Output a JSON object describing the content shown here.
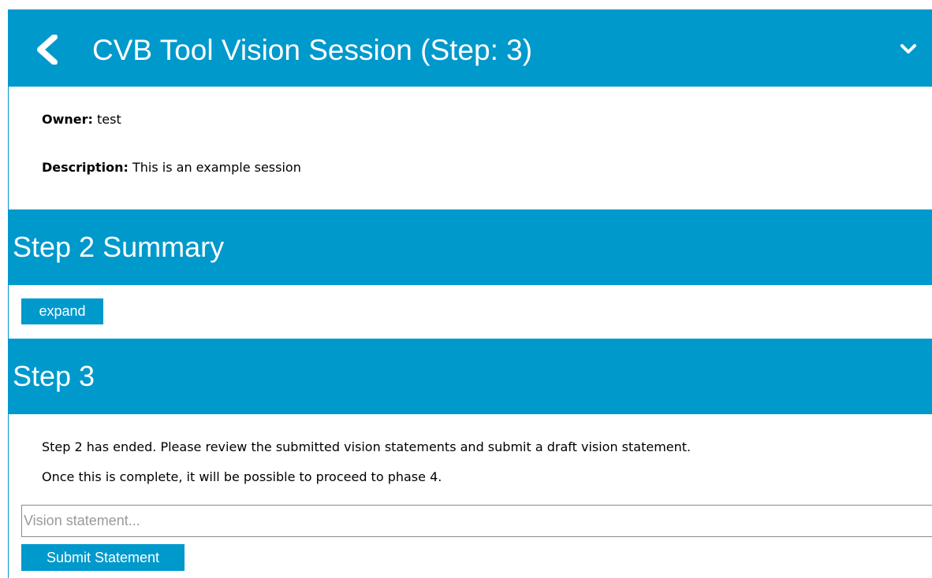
{
  "header": {
    "title": "CVB Tool Vision Session (Step: 3)",
    "back_icon": "back-chevron-left-icon",
    "menu_icon": "chevron-down-icon"
  },
  "session": {
    "owner_label": "Owner:",
    "owner_value": "test",
    "description_label": "Description:",
    "description_value": "This is an example session"
  },
  "step2_summary": {
    "heading": "Step 2 Summary",
    "expand_label": "expand"
  },
  "step3": {
    "heading": "Step 3",
    "line1": "Step 2 has ended. Please review the submitted vision statements and submit a draft vision statement.",
    "line2": "Once this is complete, it will be possible to proceed to phase 4.",
    "input_placeholder": "Vision statement...",
    "input_value": "",
    "submit_label": "Submit Statement"
  },
  "colors": {
    "accent": "#0099cc",
    "text": "#000000",
    "background": "#ffffff"
  }
}
